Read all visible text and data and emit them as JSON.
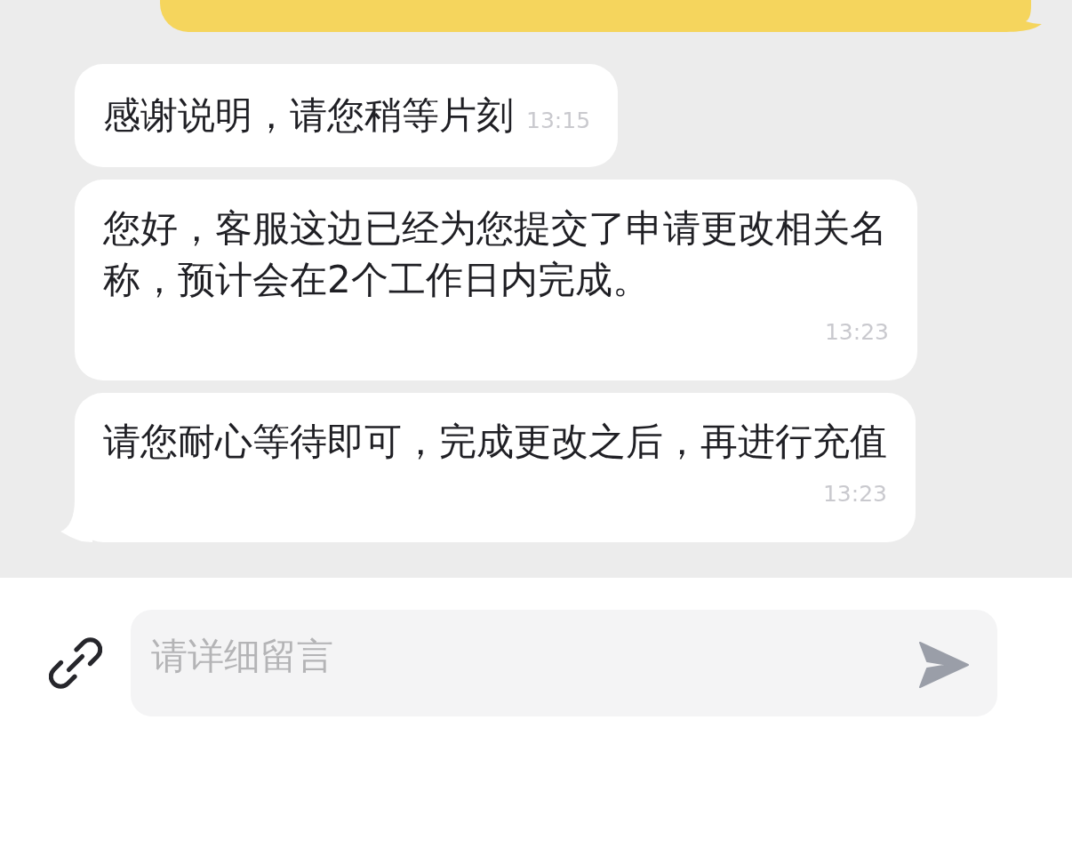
{
  "messages": [
    {
      "kind": "outgoing",
      "tail": true
    },
    {
      "kind": "incoming",
      "text": "感谢说明，请您稍等片刻",
      "time": "13:15",
      "time_inline": true,
      "tail": false
    },
    {
      "kind": "incoming",
      "text": "您好，客服这边已经为您提交了申请更改相关名称，预计会在2个工作日内完成。",
      "time": "13:23",
      "time_inline": false,
      "tail": false
    },
    {
      "kind": "incoming",
      "text": "请您耐心等待即可，完成更改之后，再进行充值",
      "time": "13:23",
      "time_inline": false,
      "tail": true
    }
  ],
  "composer": {
    "placeholder": "请详细留言"
  }
}
